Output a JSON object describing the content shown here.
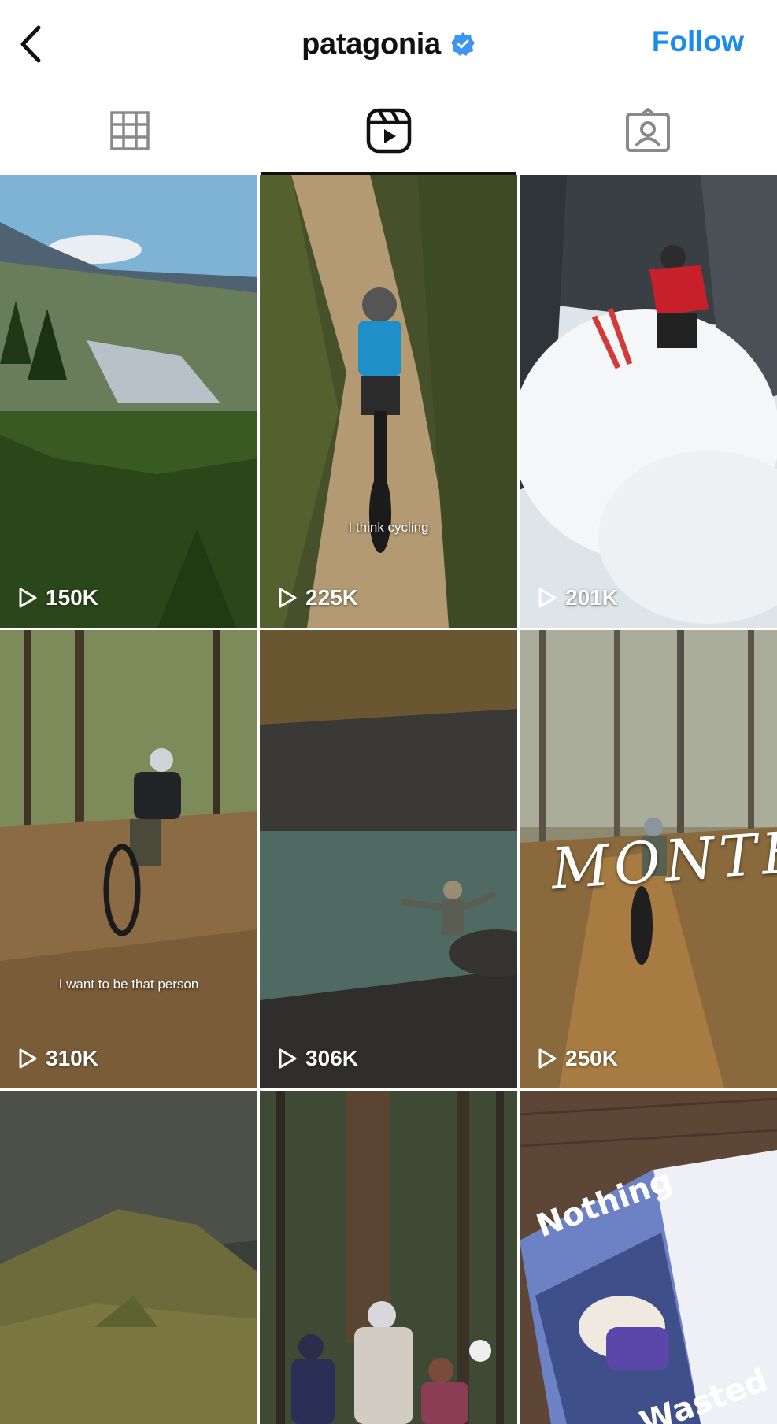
{
  "header": {
    "back_icon": "chevron-left-icon",
    "username": "patagonia",
    "verified_icon": "verified-badge-icon",
    "follow_label": "Follow",
    "accent": "#1a8cf0"
  },
  "tabs": [
    {
      "icon": "grid-icon",
      "active": false
    },
    {
      "icon": "reels-icon",
      "active": true
    },
    {
      "icon": "tagged-icon",
      "active": false
    }
  ],
  "reels": [
    {
      "views": "150K",
      "caption": ""
    },
    {
      "views": "225K",
      "caption": "I think cycling"
    },
    {
      "views": "201K",
      "caption": ""
    },
    {
      "views": "310K",
      "caption": "I want to be that person"
    },
    {
      "views": "306K",
      "caption": ""
    },
    {
      "views": "250K",
      "caption": "",
      "overlay_title": "MONTE"
    },
    {
      "views": "",
      "caption": ""
    },
    {
      "views": "",
      "caption": ""
    },
    {
      "views": "",
      "caption": "",
      "magazine_top": "Nothing",
      "magazine_bottom": "Wasted"
    }
  ]
}
